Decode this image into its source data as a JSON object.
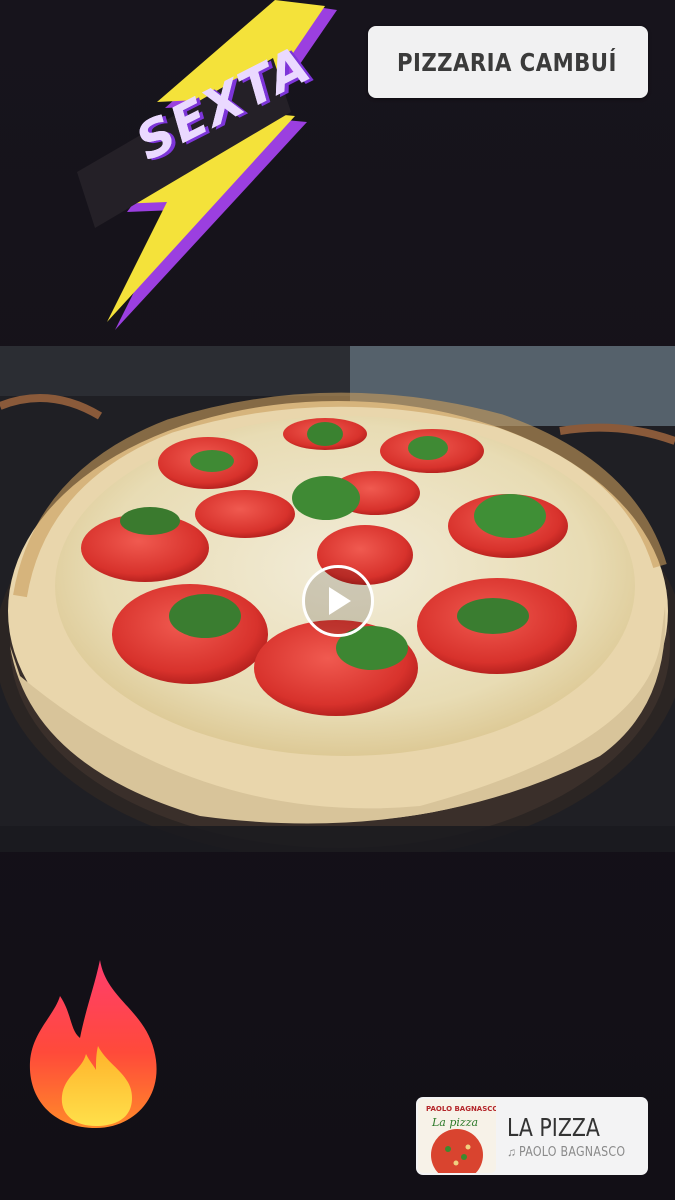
{
  "stickers": {
    "day_label": "SEXTA",
    "location": "PIZZARIA CAMBUÍ"
  },
  "media": {
    "play_icon": "play-icon"
  },
  "emoji": {
    "name": "fire-icon"
  },
  "music": {
    "title": "LA PIZZA",
    "artist": "PAOLO BAGNASCO",
    "note_icon": "♫",
    "album_art_text": "PAOLO BAGNASCO La pizza"
  },
  "colors": {
    "bolt_yellow": "#f4e23a",
    "bolt_purple": "#9b3fe0",
    "pin_blue": "#2aa3e8",
    "background": "#14121a"
  }
}
